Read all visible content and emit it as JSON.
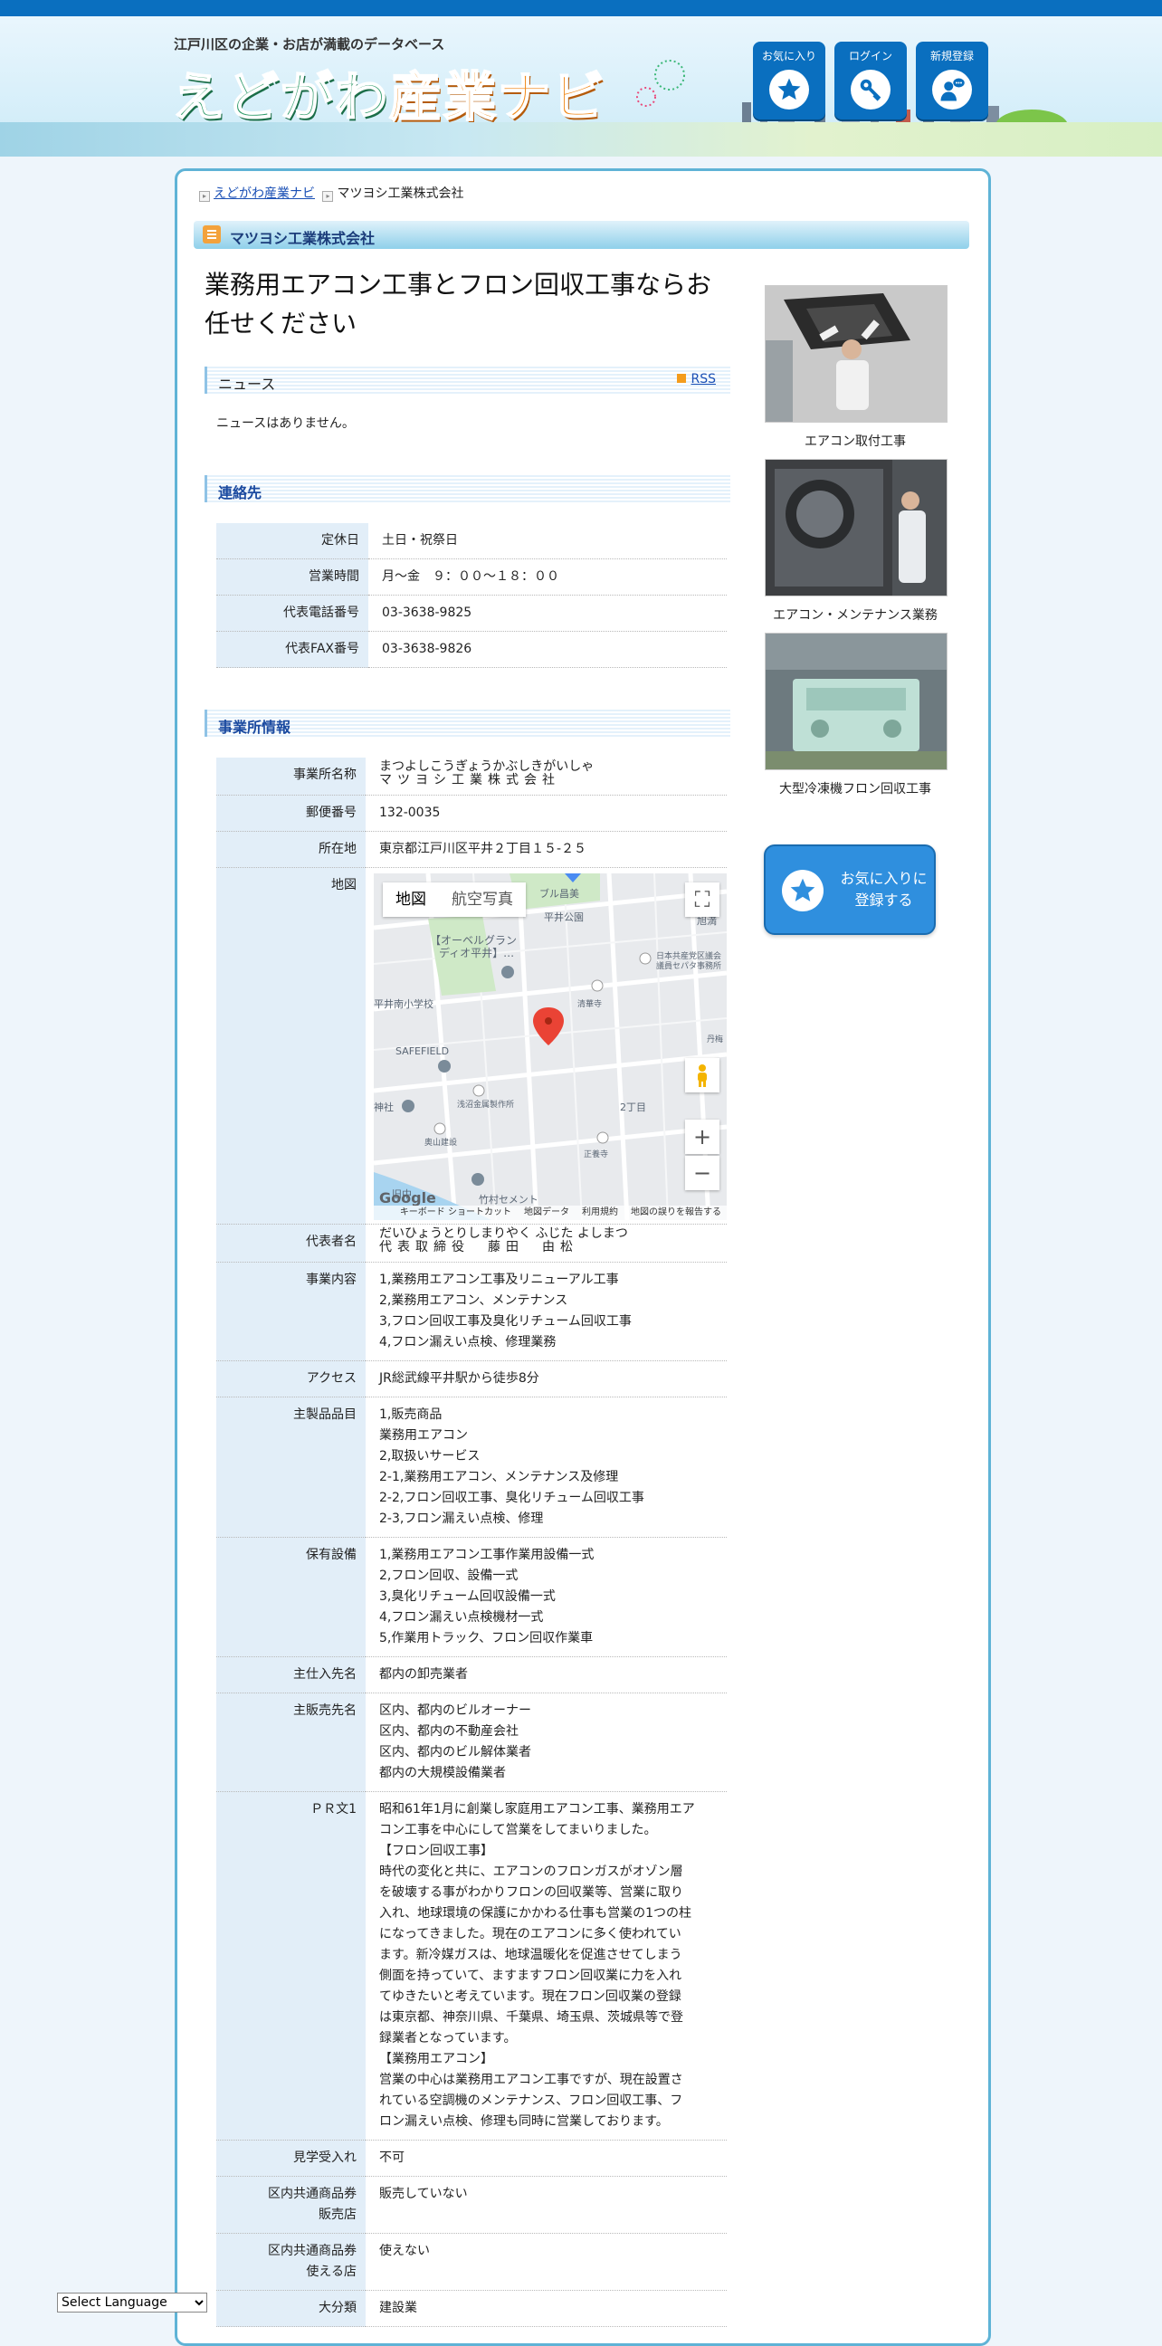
{
  "header": {
    "tagline": "江戸川区の企業・お店が満載のデータベース",
    "logo_part1": "えどがわ",
    "logo_part2": "産業ナビ",
    "buttons": {
      "favorites": "お気に入り",
      "login": "ログイン",
      "register": "新規登録"
    }
  },
  "breadcrumb": {
    "home": "えどがわ産業ナビ",
    "current": "マツヨシ工業株式会社"
  },
  "company_title": "マツヨシ工業株式会社",
  "headline": "業務用エアコン工事とフロン回収工事ならお任せください",
  "news": {
    "heading": "ニュース",
    "rss": "RSS",
    "empty": "ニュースはありません。"
  },
  "contact": {
    "heading": "連絡先",
    "rows": [
      {
        "label": "定休日",
        "value": "土日・祝祭日"
      },
      {
        "label": "営業時間",
        "value": "月～金　９：００～１８：００"
      },
      {
        "label": "代表電話番号",
        "value": "03-3638-9825"
      },
      {
        "label": "代表FAX番号",
        "value": "03-3638-9826"
      }
    ]
  },
  "office": {
    "heading": "事業所情報",
    "name_label": "事業所名称",
    "name_ruby": "まつよしこうぎょうかぶしきがいしゃ",
    "name_value": "マツヨシ工業株式会社",
    "zip_label": "郵便番号",
    "zip_value": "132-0035",
    "address_label": "所在地",
    "address_value": "東京都江戸川区平井２丁目１５-２５",
    "map_label": "地図",
    "map": {
      "tab_map": "地図",
      "tab_satellite": "航空写真",
      "labels": [
        "ブル昌美",
        "平井公園",
        "旭満",
        "【オーベルグラン",
        "ディオ平井】…",
        "日本共産党区議会",
        "議員セパタ事務所",
        "平井南小学校",
        "清華寺",
        "丹梅",
        "SAFEFIELD",
        "浅沼金属製作所",
        "神社",
        "2丁目",
        "奥山建設",
        "正養寺",
        "竹村セメント",
        "旧中"
      ],
      "footer": [
        "キーボード ショートカット",
        "地図データ",
        "利用規約",
        "地図の誤りを報告する"
      ],
      "google": "Google"
    },
    "rep_label": "代表者名",
    "rep_ruby": "だいひょうとりしまりやく ふじた よしまつ",
    "rep_value": "代表取締役　藤田　由松",
    "rows": [
      {
        "label": "事業内容",
        "lines": [
          "1,業務用エアコン工事及リニューアル工事",
          "2,業務用エアコン、メンテナンス",
          "3,フロン回収工事及臭化リチューム回収工事",
          "4,フロン漏えい点検、修理業務"
        ]
      },
      {
        "label": "アクセス",
        "lines": [
          "JR総武線平井駅から徒歩8分"
        ]
      },
      {
        "label": "主製品品目",
        "lines": [
          "1,販売商品",
          "業務用エアコン",
          "2,取扱いサービス",
          "2-1,業務用エアコン、メンテナンス及修理",
          "2-2,フロン回収工事、臭化リチューム回収工事",
          "2-3,フロン漏えい点検、修理"
        ]
      },
      {
        "label": "保有設備",
        "lines": [
          "1,業務用エアコン工事作業用設備一式",
          "2,フロン回収、設備一式",
          "3,臭化リチューム回収設備一式",
          "4,フロン漏えい点検機材一式",
          "5,作業用トラック、フロン回収作業車"
        ]
      },
      {
        "label": "主仕入先名",
        "lines": [
          "都内の卸売業者"
        ]
      },
      {
        "label": "主販売先名",
        "lines": [
          "区内、都内のビルオーナー",
          "区内、都内の不動産会社",
          "区内、都内のビル解体業者",
          "都内の大規模設備業者"
        ]
      },
      {
        "label": "ＰＲ文1",
        "lines": [
          "昭和61年1月に創業し家庭用エアコン工事、業務用エア",
          "コン工事を中心にして営業をしてまいりました。",
          "【フロン回収工事】",
          "時代の変化と共に、エアコンのフロンガスがオゾン層",
          "を破壊する事がわかりフロンの回収業等、営業に取り",
          "入れ、地球環境の保護にかかわる仕事も営業の1つの柱",
          "になってきました。現在のエアコンに多く使われてい",
          "ます。新冷媒ガスは、地球温暖化を促進させてしまう",
          "側面を持っていて、ますますフロン回収業に力を入れ",
          "てゆきたいと考えています。現在フロン回収業の登録",
          "は東京都、神奈川県、千葉県、埼玉県、茨城県等で登",
          "録業者となっています。",
          "【業務用エアコン】",
          "営業の中心は業務用エアコン工事ですが、現在設置さ",
          "れている空調機のメンテナンス、フロン回収工事、フ",
          "ロン漏えい点検、修理も同時に営業しております。"
        ]
      },
      {
        "label": "見学受入れ",
        "lines": [
          "不可"
        ]
      },
      {
        "label": "区内共通商品券\n販売店",
        "lines": [
          "販売していない"
        ]
      },
      {
        "label": "区内共通商品券\n使える店",
        "lines": [
          "使えない"
        ]
      },
      {
        "label": "大分類",
        "lines": [
          "建設業"
        ]
      }
    ]
  },
  "sidebar": {
    "photos": [
      {
        "caption": "エアコン取付工事"
      },
      {
        "caption": "エアコン・メンテナンス業務"
      },
      {
        "caption": "大型冷凍機フロン回収工事"
      }
    ],
    "favorite_button": "お気に入りに登録する"
  },
  "language": {
    "selected": "Select Language"
  },
  "colors": {
    "brand_blue": "#0a6fbf",
    "frame": "#5fb3d6",
    "label_bg": "#e2eef8",
    "link": "#1a4fb5"
  }
}
